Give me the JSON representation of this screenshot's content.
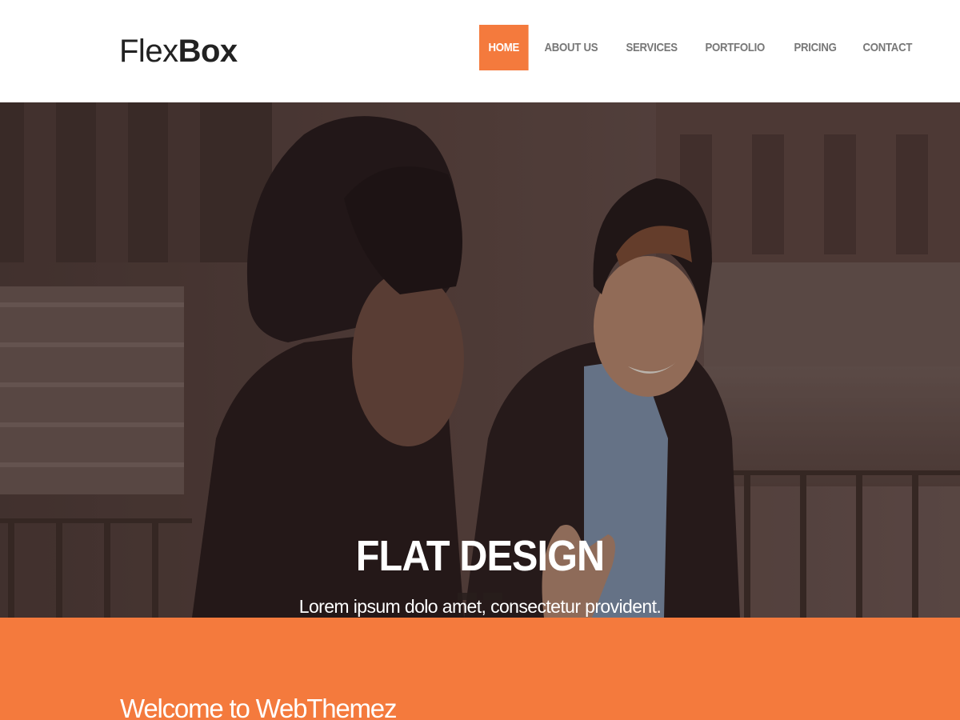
{
  "brand": {
    "logo_light": "Flex",
    "logo_bold": "Box"
  },
  "nav": {
    "items": [
      {
        "label": "HOME",
        "active": true
      },
      {
        "label": "ABOUT US",
        "active": false
      },
      {
        "label": "SERVICES",
        "active": false
      },
      {
        "label": "PORTFOLIO",
        "active": false
      },
      {
        "label": "PRICING",
        "active": false
      },
      {
        "label": "CONTACT",
        "active": false
      }
    ]
  },
  "hero": {
    "title": "FLAT DESIGN",
    "subtitle": "Lorem ipsum dolo amet, consectetur provident.",
    "slide_count": 2,
    "image": "photo-two-people-smiling"
  },
  "welcome": {
    "title": "Welcome to WebThemez"
  },
  "colors": {
    "accent": "#f47a3d",
    "nav_text": "#777777",
    "logo_text": "#222222"
  }
}
